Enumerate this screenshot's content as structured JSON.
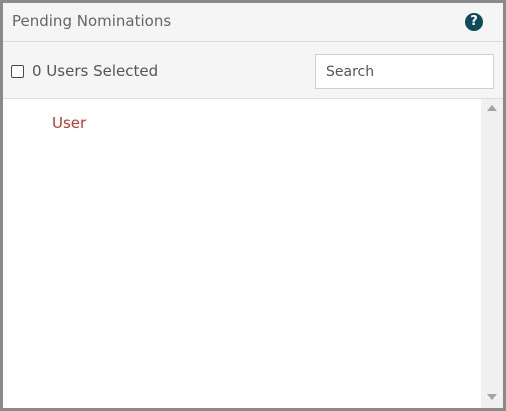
{
  "header": {
    "title": "Pending Nominations",
    "help_icon": "question-circle-icon",
    "help_glyph": "?"
  },
  "toolbar": {
    "select_all_label": "0 Users Selected",
    "search_placeholder": "Search",
    "search_value": ""
  },
  "list": {
    "items": [
      {
        "label": "User"
      }
    ]
  },
  "colors": {
    "header_bg": "#f5f5f5",
    "border": "#8a8a8a",
    "link_red": "#c0392b",
    "help_icon_bg": "#0e4a5a"
  }
}
